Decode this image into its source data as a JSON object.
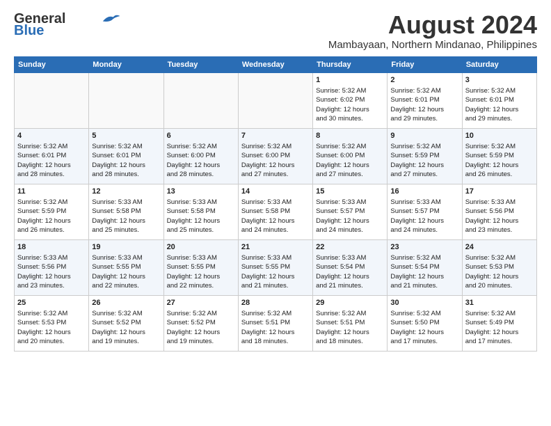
{
  "header": {
    "logo_line1": "General",
    "logo_line2": "Blue",
    "month_year": "August 2024",
    "location": "Mambayaan, Northern Mindanao, Philippines"
  },
  "weekdays": [
    "Sunday",
    "Monday",
    "Tuesday",
    "Wednesday",
    "Thursday",
    "Friday",
    "Saturday"
  ],
  "weeks": [
    [
      {
        "day": "",
        "info": ""
      },
      {
        "day": "",
        "info": ""
      },
      {
        "day": "",
        "info": ""
      },
      {
        "day": "",
        "info": ""
      },
      {
        "day": "1",
        "info": "Sunrise: 5:32 AM\nSunset: 6:02 PM\nDaylight: 12 hours\nand 30 minutes."
      },
      {
        "day": "2",
        "info": "Sunrise: 5:32 AM\nSunset: 6:01 PM\nDaylight: 12 hours\nand 29 minutes."
      },
      {
        "day": "3",
        "info": "Sunrise: 5:32 AM\nSunset: 6:01 PM\nDaylight: 12 hours\nand 29 minutes."
      }
    ],
    [
      {
        "day": "4",
        "info": "Sunrise: 5:32 AM\nSunset: 6:01 PM\nDaylight: 12 hours\nand 28 minutes."
      },
      {
        "day": "5",
        "info": "Sunrise: 5:32 AM\nSunset: 6:01 PM\nDaylight: 12 hours\nand 28 minutes."
      },
      {
        "day": "6",
        "info": "Sunrise: 5:32 AM\nSunset: 6:00 PM\nDaylight: 12 hours\nand 28 minutes."
      },
      {
        "day": "7",
        "info": "Sunrise: 5:32 AM\nSunset: 6:00 PM\nDaylight: 12 hours\nand 27 minutes."
      },
      {
        "day": "8",
        "info": "Sunrise: 5:32 AM\nSunset: 6:00 PM\nDaylight: 12 hours\nand 27 minutes."
      },
      {
        "day": "9",
        "info": "Sunrise: 5:32 AM\nSunset: 5:59 PM\nDaylight: 12 hours\nand 27 minutes."
      },
      {
        "day": "10",
        "info": "Sunrise: 5:32 AM\nSunset: 5:59 PM\nDaylight: 12 hours\nand 26 minutes."
      }
    ],
    [
      {
        "day": "11",
        "info": "Sunrise: 5:32 AM\nSunset: 5:59 PM\nDaylight: 12 hours\nand 26 minutes."
      },
      {
        "day": "12",
        "info": "Sunrise: 5:33 AM\nSunset: 5:58 PM\nDaylight: 12 hours\nand 25 minutes."
      },
      {
        "day": "13",
        "info": "Sunrise: 5:33 AM\nSunset: 5:58 PM\nDaylight: 12 hours\nand 25 minutes."
      },
      {
        "day": "14",
        "info": "Sunrise: 5:33 AM\nSunset: 5:58 PM\nDaylight: 12 hours\nand 24 minutes."
      },
      {
        "day": "15",
        "info": "Sunrise: 5:33 AM\nSunset: 5:57 PM\nDaylight: 12 hours\nand 24 minutes."
      },
      {
        "day": "16",
        "info": "Sunrise: 5:33 AM\nSunset: 5:57 PM\nDaylight: 12 hours\nand 24 minutes."
      },
      {
        "day": "17",
        "info": "Sunrise: 5:33 AM\nSunset: 5:56 PM\nDaylight: 12 hours\nand 23 minutes."
      }
    ],
    [
      {
        "day": "18",
        "info": "Sunrise: 5:33 AM\nSunset: 5:56 PM\nDaylight: 12 hours\nand 23 minutes."
      },
      {
        "day": "19",
        "info": "Sunrise: 5:33 AM\nSunset: 5:55 PM\nDaylight: 12 hours\nand 22 minutes."
      },
      {
        "day": "20",
        "info": "Sunrise: 5:33 AM\nSunset: 5:55 PM\nDaylight: 12 hours\nand 22 minutes."
      },
      {
        "day": "21",
        "info": "Sunrise: 5:33 AM\nSunset: 5:55 PM\nDaylight: 12 hours\nand 21 minutes."
      },
      {
        "day": "22",
        "info": "Sunrise: 5:33 AM\nSunset: 5:54 PM\nDaylight: 12 hours\nand 21 minutes."
      },
      {
        "day": "23",
        "info": "Sunrise: 5:32 AM\nSunset: 5:54 PM\nDaylight: 12 hours\nand 21 minutes."
      },
      {
        "day": "24",
        "info": "Sunrise: 5:32 AM\nSunset: 5:53 PM\nDaylight: 12 hours\nand 20 minutes."
      }
    ],
    [
      {
        "day": "25",
        "info": "Sunrise: 5:32 AM\nSunset: 5:53 PM\nDaylight: 12 hours\nand 20 minutes."
      },
      {
        "day": "26",
        "info": "Sunrise: 5:32 AM\nSunset: 5:52 PM\nDaylight: 12 hours\nand 19 minutes."
      },
      {
        "day": "27",
        "info": "Sunrise: 5:32 AM\nSunset: 5:52 PM\nDaylight: 12 hours\nand 19 minutes."
      },
      {
        "day": "28",
        "info": "Sunrise: 5:32 AM\nSunset: 5:51 PM\nDaylight: 12 hours\nand 18 minutes."
      },
      {
        "day": "29",
        "info": "Sunrise: 5:32 AM\nSunset: 5:51 PM\nDaylight: 12 hours\nand 18 minutes."
      },
      {
        "day": "30",
        "info": "Sunrise: 5:32 AM\nSunset: 5:50 PM\nDaylight: 12 hours\nand 17 minutes."
      },
      {
        "day": "31",
        "info": "Sunrise: 5:32 AM\nSunset: 5:49 PM\nDaylight: 12 hours\nand 17 minutes."
      }
    ]
  ]
}
